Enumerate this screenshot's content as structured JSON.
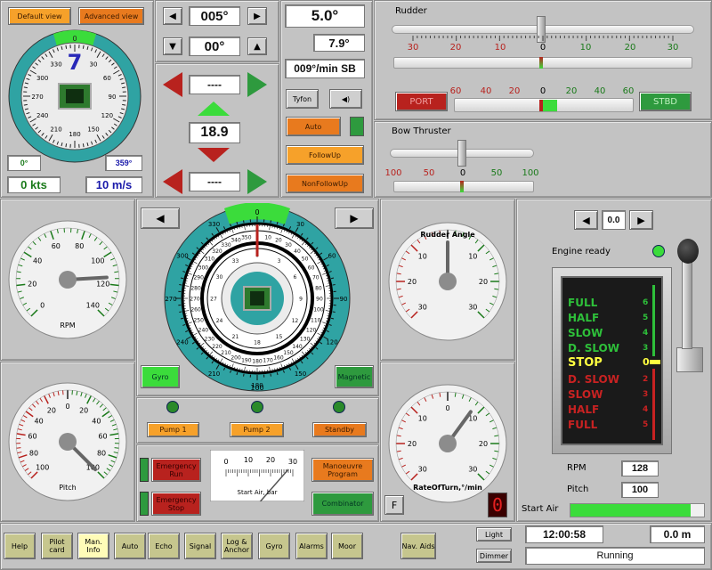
{
  "views": {
    "default": "Default view",
    "advanced": "Advanced view"
  },
  "compass_small": {
    "heading_digit": "7",
    "top_label": "0",
    "ticks": [
      "330",
      "30",
      "300",
      "60",
      "270",
      "90",
      "240",
      "120",
      "210",
      "150",
      "180"
    ]
  },
  "readouts_left": {
    "course_a": "0°",
    "course_b": "359°",
    "speed": "0 kts",
    "wind": "10 m/s"
  },
  "autopilot": {
    "heading_set": "005°",
    "heading_lock": "00°",
    "dash_top": "----",
    "rate": "18.9",
    "dash_bottom": "----"
  },
  "rate_panel": {
    "rot_main": "5.0°",
    "rot_sub": "7.9°",
    "rot_text": "009°/min SB",
    "tyfon": "Tyfon"
  },
  "modes": {
    "auto": "Auto",
    "followup": "FollowUp",
    "nonfollowup": "NonFollowUp"
  },
  "rudder": {
    "title": "Rudder",
    "scale": [
      "30",
      "20",
      "10",
      "0",
      "10",
      "20",
      "30"
    ],
    "scale2": [
      "60",
      "40",
      "20",
      "0",
      "20",
      "40",
      "60"
    ],
    "port": "PORT",
    "stbd": "STBD"
  },
  "bow": {
    "title": "Bow Thruster",
    "scale": [
      "100",
      "50",
      "0",
      "50",
      "100"
    ]
  },
  "rpm_gauge": {
    "label": "RPM",
    "ticks": [
      "0",
      "20",
      "40",
      "60",
      "80",
      "100",
      "120",
      "140"
    ],
    "needle_value": 115
  },
  "pitch_gauge": {
    "label": "Pitch",
    "ticks": [
      "100",
      "80",
      "60",
      "40",
      "20",
      "0",
      "20",
      "40",
      "60",
      "80",
      "100"
    ],
    "needle_value": 100
  },
  "rudder_angle_gauge": {
    "label": "Rudder Angle",
    "ticks": [
      "30",
      "20",
      "10",
      "0",
      "10",
      "20",
      "30"
    ],
    "needle_value": 0
  },
  "rot_gauge": {
    "label": "RateOfTurn,°/min",
    "ticks": [
      "30",
      "20",
      "10",
      "0",
      "10",
      "20",
      "30"
    ],
    "needle_value": 8
  },
  "big_compass": {
    "top": "0",
    "outer": [
      "330",
      "30",
      "300",
      "60",
      "270",
      "90",
      "240",
      "120",
      "210",
      "150",
      "180"
    ],
    "bottom": "100"
  },
  "compass_modes": {
    "gyro": "Gyro",
    "magnetic": "Magnetic"
  },
  "pumps": {
    "pump1": "Pump 1",
    "pump2": "Pump 2",
    "standby": "Standby"
  },
  "emergency": {
    "run": "Emergency Run",
    "stop": "Emergency Stop",
    "manoeuvre": "Manoeuvre Program",
    "combinator": "Combinator",
    "f": "F",
    "digit": "0"
  },
  "start_air": {
    "label": "Start Air, bar",
    "ticks": [
      "0",
      "10",
      "20",
      "30"
    ],
    "level": 0.9,
    "bottom_label": "Start Air"
  },
  "telegraph": {
    "value": "0.0",
    "ready": "Engine ready",
    "rpm_label": "RPM",
    "rpm": "128",
    "pitch_label": "Pitch",
    "pitch": "100",
    "ahead": [
      {
        "t": "FULL",
        "n": "6"
      },
      {
        "t": "HALF",
        "n": "5"
      },
      {
        "t": "SLOW",
        "n": "4"
      },
      {
        "t": "D. SLOW",
        "n": "3"
      }
    ],
    "stop": {
      "t": "STOP",
      "n": "0"
    },
    "astern": [
      {
        "t": "D. SLOW",
        "n": "2"
      },
      {
        "t": "SLOW",
        "n": "3"
      },
      {
        "t": "HALF",
        "n": "4"
      },
      {
        "t": "FULL",
        "n": "5"
      }
    ]
  },
  "bottom_nav": [
    {
      "l": "Help"
    },
    {
      "l": "Pilot card"
    },
    {
      "l": "Man. Info"
    },
    {
      "l": "Auto"
    },
    {
      "l": "Echo"
    },
    {
      "l": "Signal"
    },
    {
      "l": "Log & Anchor"
    },
    {
      "l": "Gyro"
    },
    {
      "l": "Alarms"
    },
    {
      "l": "Moor"
    }
  ],
  "nav_aids": "Nav. Aids",
  "light": "Light",
  "dimmer": "Dimmer",
  "clock": "12:00:58",
  "depth": "0.0 m",
  "status": "Running",
  "colors": {
    "orange": "#e87a1e",
    "green": "#2e9a3e",
    "red": "#b8221e",
    "teal": "#2fa3a3"
  }
}
